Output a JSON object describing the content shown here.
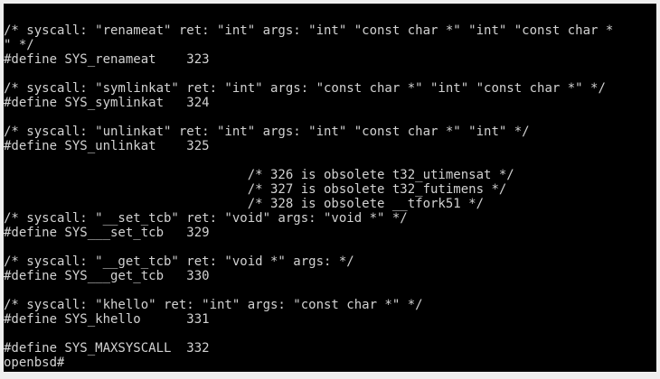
{
  "terminal": {
    "lines": [
      "/* syscall: \"renameat\" ret: \"int\" args: \"int\" \"const char *\" \"int\" \"const char *",
      "\" */",
      "#define SYS_renameat    323",
      "",
      "/* syscall: \"symlinkat\" ret: \"int\" args: \"const char *\" \"int\" \"const char *\" */",
      "#define SYS_symlinkat   324",
      "",
      "/* syscall: \"unlinkat\" ret: \"int\" args: \"int\" \"const char *\" \"int\" */",
      "#define SYS_unlinkat    325",
      "",
      "                                /* 326 is obsolete t32_utimensat */",
      "                                /* 327 is obsolete t32_futimens */",
      "                                /* 328 is obsolete __tfork51 */",
      "/* syscall: \"__set_tcb\" ret: \"void\" args: \"void *\" */",
      "#define SYS___set_tcb   329",
      "",
      "/* syscall: \"__get_tcb\" ret: \"void *\" args: */",
      "#define SYS___get_tcb   330",
      "",
      "/* syscall: \"khello\" ret: \"int\" args: \"const char *\" */",
      "#define SYS_khello      331",
      "",
      "#define SYS_MAXSYSCALL  332"
    ],
    "prompt": "openbsd#"
  }
}
